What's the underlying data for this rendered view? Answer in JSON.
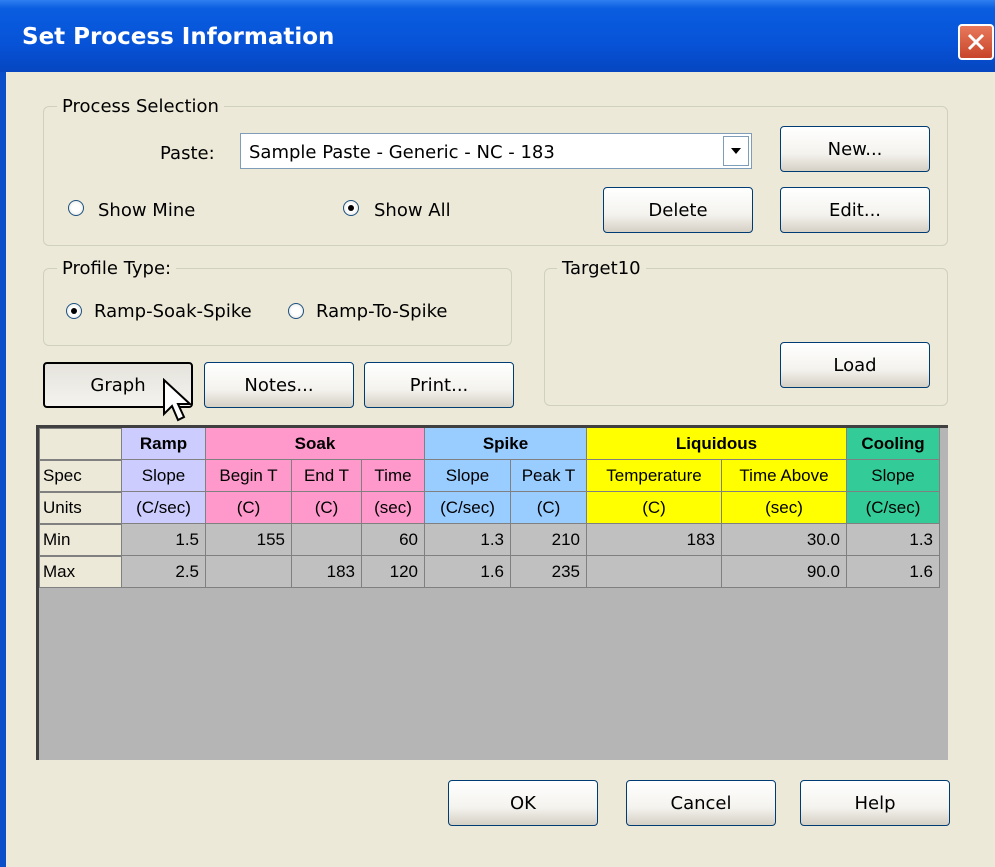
{
  "window": {
    "title": "Set Process Information"
  },
  "process_selection": {
    "legend": "Process Selection",
    "paste_label": "Paste:",
    "paste_value": "Sample Paste - Generic - NC - 183",
    "new_label": "New...",
    "delete_label": "Delete",
    "edit_label": "Edit...",
    "show_mine_label": "Show Mine",
    "show_all_label": "Show All",
    "selected_filter": "Show All"
  },
  "profile_type": {
    "legend": "Profile Type:",
    "options": [
      "Ramp-Soak-Spike",
      "Ramp-To-Spike"
    ],
    "selected": "Ramp-Soak-Spike"
  },
  "target": {
    "legend": "Target10",
    "load_label": "Load"
  },
  "buttons": {
    "graph": "Graph",
    "notes": "Notes...",
    "print": "Print...",
    "ok": "OK",
    "cancel": "Cancel",
    "help": "Help"
  },
  "colors": {
    "ramp": "#ccccff",
    "soak": "#ff99cc",
    "spike": "#99ccff",
    "liquidous": "#ffff00",
    "cooling": "#33cc99",
    "value_cell": "#c0c0c0"
  },
  "table": {
    "groups": [
      "Ramp",
      "Soak",
      "Spike",
      "Liquidous",
      "Cooling"
    ],
    "row_labels": [
      "Spec",
      "Units",
      "Min",
      "Max"
    ],
    "spec": [
      "Slope",
      "Begin T",
      "End T",
      "Time",
      "Slope",
      "Peak T",
      "Temperature",
      "Time Above",
      "Slope"
    ],
    "units": [
      "(C/sec)",
      "(C)",
      "(C)",
      "(sec)",
      "(C/sec)",
      "(C)",
      "(C)",
      "(sec)",
      "(C/sec)"
    ],
    "min": [
      "1.5",
      "155",
      "",
      "60",
      "1.3",
      "210",
      "183",
      "30.0",
      "1.3"
    ],
    "max": [
      "2.5",
      "",
      "183",
      "120",
      "1.6",
      "235",
      "",
      "90.0",
      "1.6"
    ]
  }
}
